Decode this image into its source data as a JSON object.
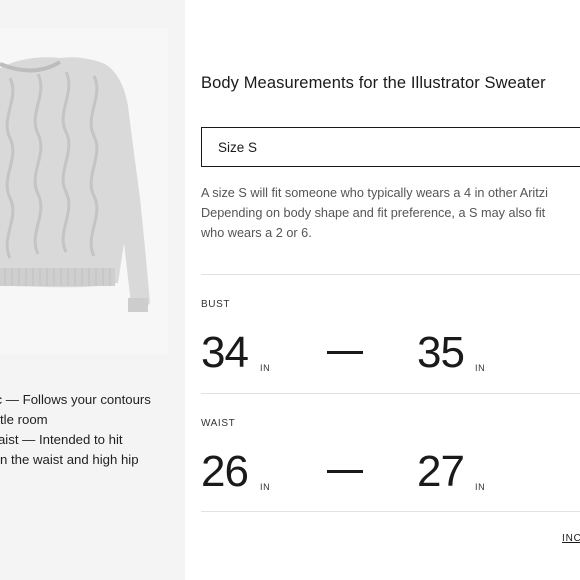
{
  "product": {
    "image_description": "grey-cable-knit-sweater"
  },
  "fit_notes": [
    {
      "line1": "sic — Follows your contours",
      "line2": "tle room"
    },
    {
      "line1": "Waist — Intended to hit",
      "line2": "n the waist and high hip"
    }
  ],
  "modal": {
    "title": "Body Measurements for the Illustrator Sweater",
    "size_select": {
      "value": "Size S"
    },
    "description_lines": [
      "A size S will fit someone who typically wears a 4 in other Aritzi",
      "Depending on body shape and fit preference, a S may also fit",
      "who wears a 2 or 6."
    ],
    "measurements": [
      {
        "label": "BUST",
        "min": "34",
        "max": "35",
        "unit": "IN"
      },
      {
        "label": "WAIST",
        "min": "26",
        "max": "27",
        "unit": "IN"
      }
    ],
    "units_link": "INC"
  },
  "colors": {
    "left_bg": "#f4f4f4",
    "text": "#1a1a1a",
    "muted_text": "#555555",
    "divider": "#e2e2e2"
  }
}
